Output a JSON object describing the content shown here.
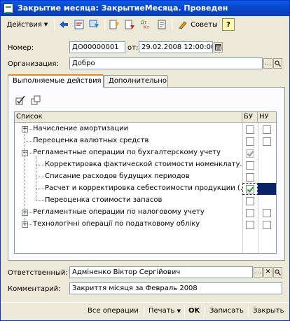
{
  "window": {
    "title": "Закрытие месяца: ЗакрытиеМесяца. Проведен"
  },
  "toolbar": {
    "actions_label": "Действия",
    "advice_label": "Советы",
    "help_label": "?"
  },
  "header": {
    "number_label": "Номер:",
    "number_value": "ДО00000001",
    "from_label": "от:",
    "date_value": "29.02.2008 12:00:00",
    "org_label": "Организация:",
    "org_value": "Добро"
  },
  "tabs": [
    {
      "label": "Выполняемые действия",
      "active": true
    },
    {
      "label": "Дополнительно",
      "active": false
    }
  ],
  "grid": {
    "columns": [
      "Список",
      "БУ",
      "НУ"
    ],
    "rows": [
      {
        "label": "Начисление амортизации",
        "level": 0,
        "expander": "+",
        "bu": false,
        "nu": false,
        "bu_disabled": false,
        "nu_visible": true
      },
      {
        "label": "Переоценка валютных средств",
        "level": 0,
        "expander": "",
        "bu": false,
        "nu": false,
        "bu_disabled": false,
        "nu_visible": true
      },
      {
        "label": "Регламентные операции по бухгалтерскому учету",
        "level": 0,
        "expander": "-",
        "bu": true,
        "nu": false,
        "bu_disabled": true,
        "nu_visible": false
      },
      {
        "label": "Корректировка фактической стоимости номенклату...",
        "level": 1,
        "expander": "",
        "bu": false,
        "nu": false,
        "bu_disabled": false,
        "nu_visible": false
      },
      {
        "label": "Списание расходов будущих периодов",
        "level": 1,
        "expander": "",
        "bu": false,
        "nu": false,
        "bu_disabled": false,
        "nu_visible": false
      },
      {
        "label": "Расчет и корректировка себестоимости продукции (...",
        "level": 1,
        "expander": "",
        "bu": true,
        "nu": false,
        "bu_disabled": false,
        "nu_visible": false,
        "selected": true
      },
      {
        "label": "Переоценка стоимости запасов",
        "level": 1,
        "expander": "",
        "bu": false,
        "nu": false,
        "bu_disabled": false,
        "nu_visible": false
      },
      {
        "label": "Регламентные операции по налоговому учету",
        "level": 0,
        "expander": "+",
        "bu": false,
        "nu": false,
        "bu_disabled": false,
        "nu_visible": true
      },
      {
        "label": "Технологічні операції по податковому обліку",
        "level": 0,
        "expander": "+",
        "bu": false,
        "nu": false,
        "bu_disabled": false,
        "nu_visible": true
      }
    ]
  },
  "footer": {
    "responsible_label": "Ответственный:",
    "responsible_value": "Адміненко Віктор Сергійович",
    "comment_label": "Комментарий:",
    "comment_value": "Закриття місяця за Февраль 2008"
  },
  "bottom": {
    "all_ops": "Все операции",
    "print": "Печать",
    "ok": "OK",
    "save": "Записать",
    "close": "Закрыть"
  }
}
